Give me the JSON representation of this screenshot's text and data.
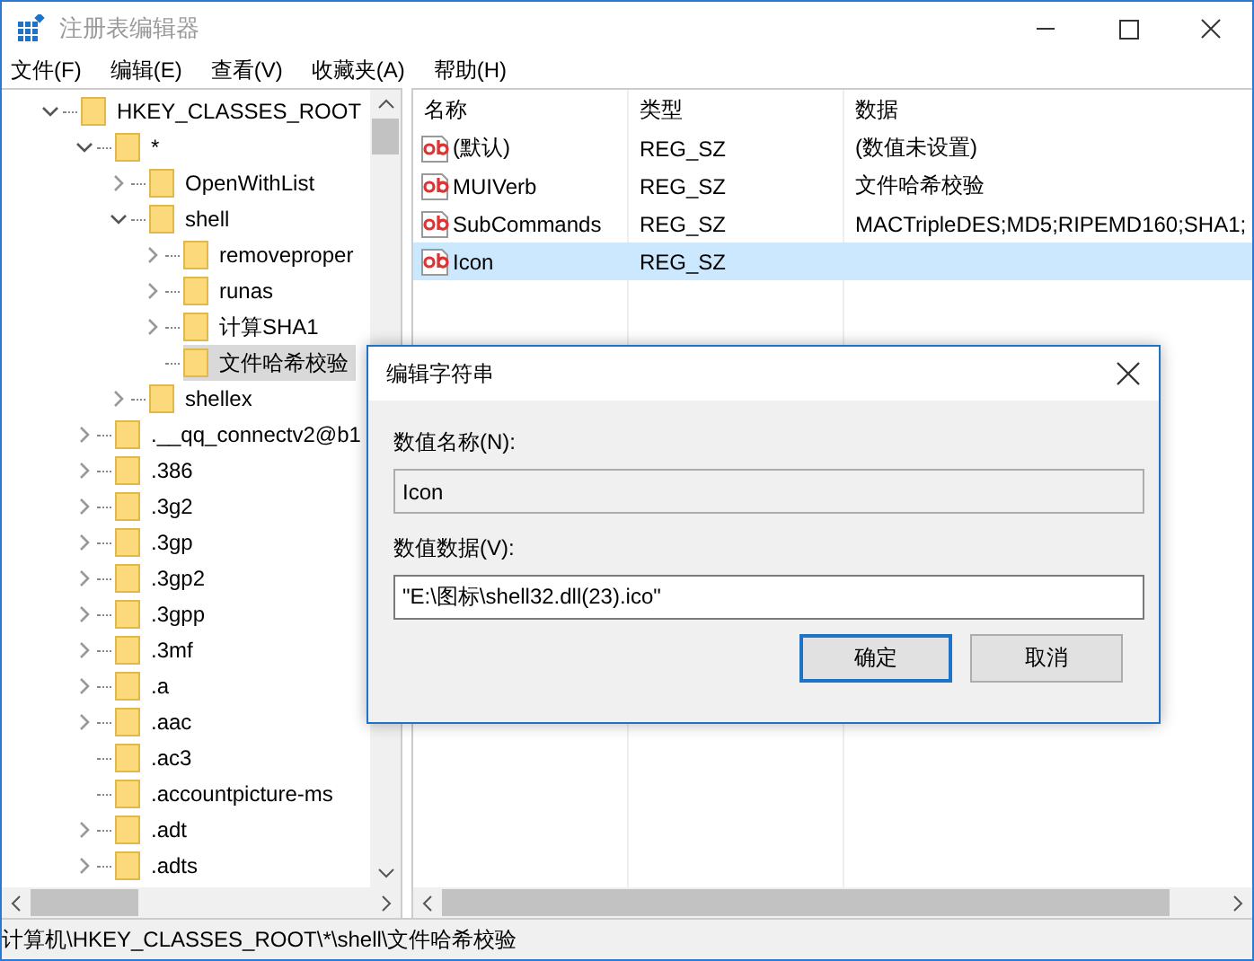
{
  "window": {
    "title": "注册表编辑器"
  },
  "menu": [
    "文件(F)",
    "编辑(E)",
    "查看(V)",
    "收藏夹(A)",
    "帮助(H)"
  ],
  "tree": [
    {
      "label": "HKEY_CLASSES_ROOT",
      "has_children": true,
      "expanded": true,
      "selected": false,
      "children": [
        {
          "label": "*",
          "has_children": true,
          "expanded": true,
          "selected": false,
          "children": [
            {
              "label": "OpenWithList",
              "has_children": true,
              "expanded": false,
              "selected": false
            },
            {
              "label": "shell",
              "has_children": true,
              "expanded": true,
              "selected": false,
              "children": [
                {
                  "label": "removeproper",
                  "has_children": true,
                  "expanded": false,
                  "selected": false
                },
                {
                  "label": "runas",
                  "has_children": true,
                  "expanded": false,
                  "selected": false
                },
                {
                  "label": "计算SHA1",
                  "has_children": true,
                  "expanded": false,
                  "selected": false
                },
                {
                  "label": "文件哈希校验",
                  "has_children": false,
                  "selected": true
                }
              ]
            },
            {
              "label": "shellex",
              "has_children": true,
              "expanded": false,
              "selected": false
            }
          ]
        },
        {
          "label": ".__qq_connectv2@b1",
          "has_children": true,
          "expanded": false,
          "selected": false
        },
        {
          "label": ".386",
          "has_children": true,
          "expanded": false,
          "selected": false
        },
        {
          "label": ".3g2",
          "has_children": true,
          "expanded": false,
          "selected": false
        },
        {
          "label": ".3gp",
          "has_children": true,
          "expanded": false,
          "selected": false
        },
        {
          "label": ".3gp2",
          "has_children": true,
          "expanded": false,
          "selected": false
        },
        {
          "label": ".3gpp",
          "has_children": true,
          "expanded": false,
          "selected": false
        },
        {
          "label": ".3mf",
          "has_children": true,
          "expanded": false,
          "selected": false
        },
        {
          "label": ".a",
          "has_children": true,
          "expanded": false,
          "selected": false
        },
        {
          "label": ".aac",
          "has_children": true,
          "expanded": false,
          "selected": false
        },
        {
          "label": ".ac3",
          "has_children": false,
          "selected": false
        },
        {
          "label": ".accountpicture-ms",
          "has_children": false,
          "selected": false
        },
        {
          "label": ".adt",
          "has_children": true,
          "expanded": false,
          "selected": false
        },
        {
          "label": ".adts",
          "has_children": true,
          "expanded": false,
          "selected": false
        }
      ]
    }
  ],
  "table": {
    "columns": [
      "名称",
      "类型",
      "数据"
    ],
    "rows": [
      {
        "name": "(默认)",
        "type": "REG_SZ",
        "data": "(数值未设置)",
        "selected": false
      },
      {
        "name": "MUIVerb",
        "type": "REG_SZ",
        "data": "文件哈希校验",
        "selected": false
      },
      {
        "name": "SubCommands",
        "type": "REG_SZ",
        "data": "MACTripleDES;MD5;RIPEMD160;SHA1;",
        "selected": false
      },
      {
        "name": "Icon",
        "type": "REG_SZ",
        "data": "",
        "selected": true
      }
    ]
  },
  "dialog": {
    "title": "编辑字符串",
    "name_label": "数值名称(N):",
    "name_value": "Icon",
    "data_label": "数值数据(V):",
    "data_value": "\"E:\\图标\\shell32.dll(23).ico\"",
    "buttons": [
      {
        "label": "确定",
        "default": true
      },
      {
        "label": "取消",
        "default": false
      }
    ]
  },
  "status_bar": "计算机\\HKEY_CLASSES_ROOT\\*\\shell\\文件哈希校验"
}
